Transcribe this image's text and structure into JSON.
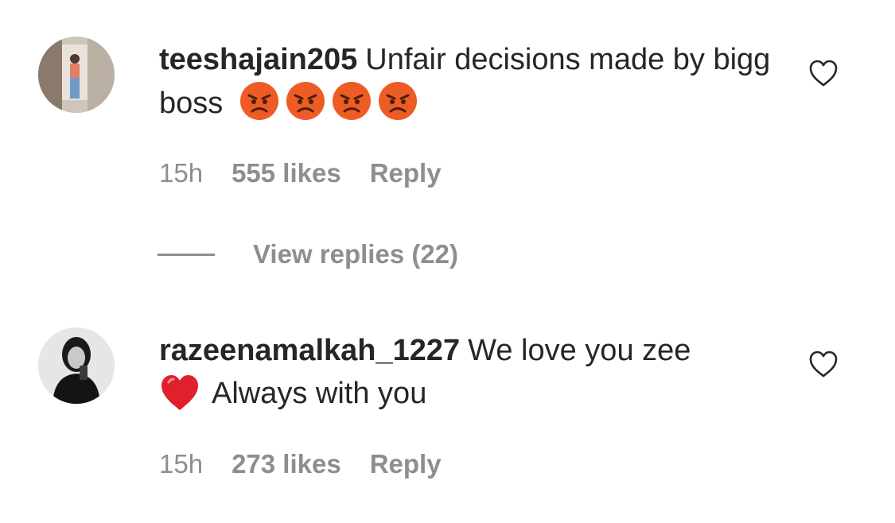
{
  "comments": [
    {
      "username": "teeshajain205",
      "text": "Unfair decisions made by bigg boss",
      "emojis": [
        "angry-face",
        "angry-face",
        "angry-face",
        "angry-face"
      ],
      "time": "15h",
      "likes": "555 likes",
      "reply_label": "Reply",
      "view_replies": "View replies (22)"
    },
    {
      "username": "razeenamalkah_1227",
      "text_part1": "We love you zee",
      "emoji": "red-heart",
      "text_part2": "Always with you",
      "time": "15h",
      "likes": "273 likes",
      "reply_label": "Reply"
    }
  ],
  "colors": {
    "text": "#262626",
    "secondary": "#8e8e8e",
    "background": "#ffffff"
  }
}
